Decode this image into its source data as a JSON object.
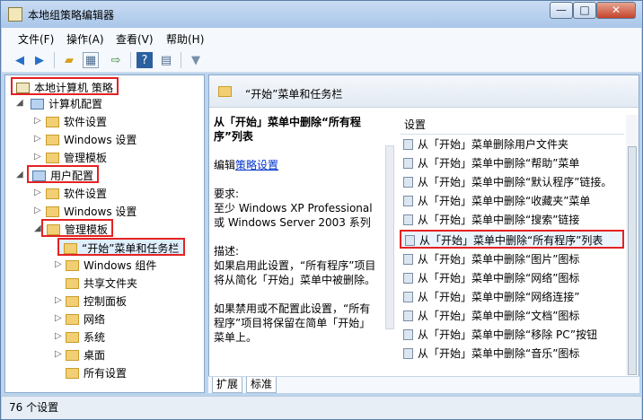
{
  "window": {
    "title": "本地组策略编辑器",
    "minimize": "—",
    "maximize": "□",
    "close": "✕"
  },
  "menu": [
    "文件(F)",
    "操作(A)",
    "查看(V)",
    "帮助(H)"
  ],
  "toolbar": [
    "back-icon",
    "forward-icon",
    "folder-up-icon",
    "show-hide-tree-icon",
    "export-icon",
    "help-icon",
    "properties-icon",
    "filter-icon"
  ],
  "tree": {
    "root": "本地计算机 策略",
    "computer": "计算机配置",
    "computer_children": [
      "软件设置",
      "Windows 设置",
      "管理模板"
    ],
    "user": "用户配置",
    "user_children": [
      "软件设置",
      "Windows 设置",
      "管理模板"
    ],
    "selected": "“开始”菜单和任务栏",
    "admin_children": [
      "Windows 组件",
      "共享文件夹",
      "控制面板",
      "网络",
      "系统",
      "桌面",
      "所有设置"
    ]
  },
  "right": {
    "header": "“开始”菜单和任务栏",
    "policy_title": "从「开始」菜单中删除“所有程序”列表",
    "edit_prefix": "编辑",
    "edit_link": "策略设置",
    "requirement_label": "要求:",
    "requirement_text": "至少 Windows XP Professional 或 Windows Server 2003 系列",
    "description_label": "描述:",
    "description_1": "如果启用此设置，“所有程序”项目将从简化「开始」菜单中被删除。",
    "description_2": "如果禁用或不配置此设置，“所有程序”项目将保留在简单「开始」菜单上。",
    "list_header": "设置",
    "settings": [
      "从「开始」菜单删除用户文件夹",
      "从「开始」菜单中删除“帮助”菜单",
      "从「开始」菜单中删除“默认程序”链接。",
      "从「开始」菜单中删除“收藏夹”菜单",
      "从「开始」菜单中删除“搜索”链接",
      "从「开始」菜单中删除“所有程序”列表",
      "从「开始」菜单中删除“图片”图标",
      "从「开始」菜单中删除“网络”图标",
      "从「开始」菜单中删除“网络连接”",
      "从「开始」菜单中删除“文档”图标",
      "从「开始」菜单中删除“移除 PC”按钮",
      "从「开始」菜单中删除“音乐”图标"
    ],
    "tabs": [
      "扩展",
      "标准"
    ]
  },
  "status": "76 个设置",
  "colors": {
    "highlight": "#e52222",
    "link": "#0033cc"
  }
}
